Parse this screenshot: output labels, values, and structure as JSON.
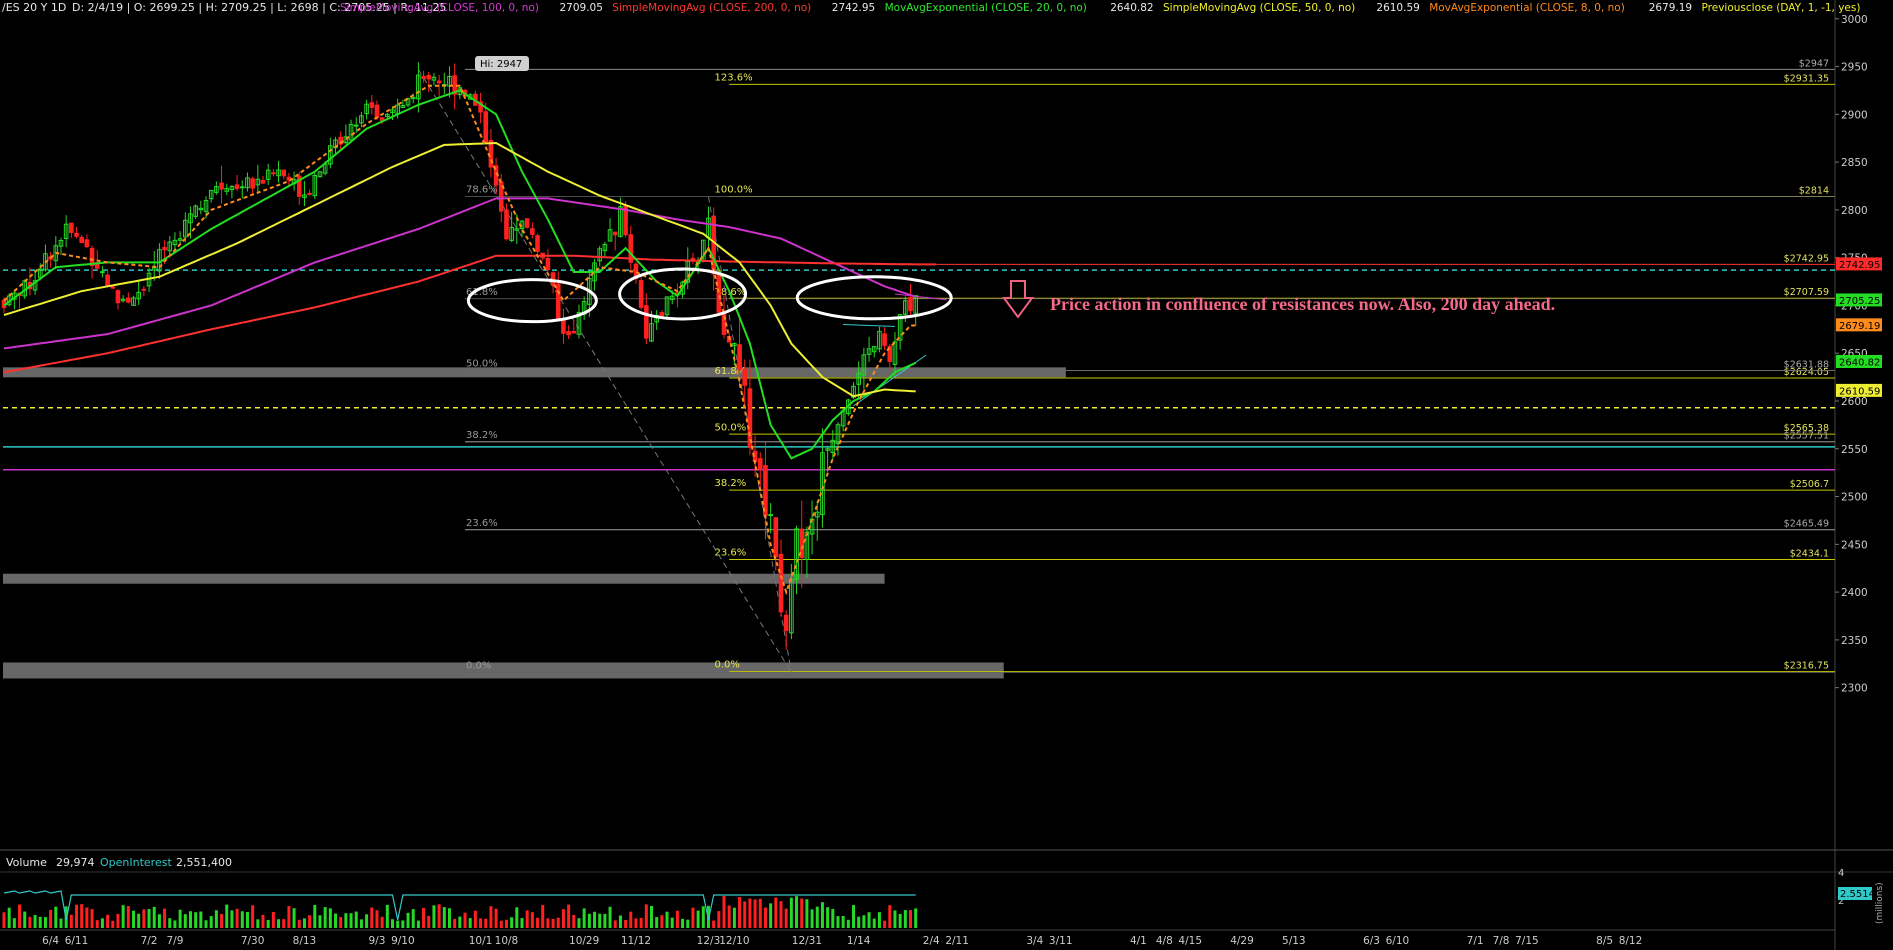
{
  "header": {
    "symbol": "/ES 20 Y 1D",
    "ohlc": "D: 2/4/19 | O: 2699.25 | H: 2709.25 | L: 2698 | C: 2705.25 | R: 11.25",
    "studies": [
      {
        "label": "SimpleMovingAvg (CLOSE, 100, 0, no)",
        "value": "2709.05",
        "color": "#d43ad4"
      },
      {
        "label": "SimpleMovingAvg (CLOSE, 200, 0, no)",
        "value": "2742.95",
        "color": "#ff3b30"
      },
      {
        "label": "MovAvgExponential (CLOSE, 20, 0, no)",
        "value": "2640.82",
        "color": "#2ee82e"
      },
      {
        "label": "SimpleMovingAvg (CLOSE, 50, 0, no)",
        "value": "2610.59",
        "color": "#f0f02a"
      },
      {
        "label": "MovAvgExponential (CLOSE, 8, 0, no)",
        "value": "2679.19",
        "color": "#ff8a1c"
      },
      {
        "label": "Previousclose (DAY, 1, -1, yes)",
        "value": "",
        "color": "#f0f02a"
      }
    ]
  },
  "colors": {
    "bg": "#000000",
    "up": "#26d926",
    "down": "#ff2020",
    "sma100": "#cc33cc",
    "sma200": "#ff3030",
    "ema20": "#22dd22",
    "sma50": "#eeee33",
    "ema8": "#ff8c1a",
    "fib": "#c8c800",
    "cyan": "#30c8c8"
  },
  "chart_data": {
    "type": "candlestick",
    "title": "/ES 20 Y 1D",
    "ylim": [
      2285,
      3005
    ],
    "yticks": [
      2300,
      2350,
      2400,
      2450,
      2500,
      2550,
      2600,
      2650,
      2700,
      2750,
      2800,
      2850,
      2900,
      2950,
      3000
    ],
    "xticks": [
      {
        "label": "6/4",
        "i": 9
      },
      {
        "label": "6/11",
        "i": 14
      },
      {
        "label": "7/2",
        "i": 28
      },
      {
        "label": "7/9",
        "i": 33
      },
      {
        "label": "7/30",
        "i": 48
      },
      {
        "label": "8/13",
        "i": 58
      },
      {
        "label": "9/3",
        "i": 72
      },
      {
        "label": "9/10",
        "i": 77
      },
      {
        "label": "10/1",
        "i": 92
      },
      {
        "label": "10/8",
        "i": 97
      },
      {
        "label": "10/29",
        "i": 112
      },
      {
        "label": "11/12",
        "i": 122
      },
      {
        "label": "12/3",
        "i": 136
      },
      {
        "label": "12/10",
        "i": 141
      },
      {
        "label": "12/31",
        "i": 155
      },
      {
        "label": "1/14",
        "i": 165
      },
      {
        "label": "2/4",
        "i": 179
      },
      {
        "label": "2/11",
        "i": 184
      },
      {
        "label": "3/4",
        "i": 199
      },
      {
        "label": "3/11",
        "i": 204
      },
      {
        "label": "4/1",
        "i": 219
      },
      {
        "label": "4/8",
        "i": 224
      },
      {
        "label": "4/15",
        "i": 229
      },
      {
        "label": "4/29",
        "i": 239
      },
      {
        "label": "5/13",
        "i": 249
      },
      {
        "label": "6/3",
        "i": 264
      },
      {
        "label": "6/10",
        "i": 269
      },
      {
        "label": "7/1",
        "i": 284
      },
      {
        "label": "7/8",
        "i": 289
      },
      {
        "label": "7/15",
        "i": 294
      },
      {
        "label": "8/5",
        "i": 309
      },
      {
        "label": "8/12",
        "i": 314
      }
    ],
    "anchors": [
      [
        0,
        2705
      ],
      [
        5,
        2725
      ],
      [
        12,
        2780
      ],
      [
        17,
        2755
      ],
      [
        22,
        2705
      ],
      [
        27,
        2715
      ],
      [
        30,
        2750
      ],
      [
        36,
        2800
      ],
      [
        42,
        2825
      ],
      [
        47,
        2830
      ],
      [
        53,
        2840
      ],
      [
        58,
        2820
      ],
      [
        63,
        2860
      ],
      [
        68,
        2900
      ],
      [
        73,
        2895
      ],
      [
        78,
        2915
      ],
      [
        82,
        2945
      ],
      [
        85,
        2935
      ],
      [
        88,
        2930
      ],
      [
        92,
        2905
      ],
      [
        95,
        2825
      ],
      [
        97,
        2765
      ],
      [
        99,
        2790
      ],
      [
        102,
        2775
      ],
      [
        105,
        2735
      ],
      [
        108,
        2665
      ],
      [
        111,
        2685
      ],
      [
        115,
        2755
      ],
      [
        119,
        2795
      ],
      [
        122,
        2730
      ],
      [
        124,
        2670
      ],
      [
        126,
        2680
      ],
      [
        130,
        2720
      ],
      [
        134,
        2750
      ],
      [
        136,
        2790
      ],
      [
        138,
        2690
      ],
      [
        140,
        2665
      ],
      [
        143,
        2600
      ],
      [
        146,
        2520
      ],
      [
        148,
        2480
      ],
      [
        150,
        2400
      ],
      [
        151,
        2350
      ],
      [
        152,
        2430
      ],
      [
        154,
        2460
      ],
      [
        156,
        2465
      ],
      [
        157,
        2500
      ],
      [
        159,
        2550
      ],
      [
        161,
        2580
      ],
      [
        163,
        2605
      ],
      [
        165,
        2625
      ],
      [
        167,
        2650
      ],
      [
        169,
        2670
      ],
      [
        171,
        2640
      ],
      [
        173,
        2685
      ],
      [
        175,
        2705
      ]
    ],
    "moving_averages": [
      {
        "name": "SMA100",
        "color": "#cc33cc",
        "points": [
          [
            0,
            2655
          ],
          [
            20,
            2670
          ],
          [
            40,
            2700
          ],
          [
            60,
            2745
          ],
          [
            80,
            2780
          ],
          [
            95,
            2812
          ],
          [
            105,
            2812
          ],
          [
            120,
            2800
          ],
          [
            130,
            2790
          ],
          [
            140,
            2782
          ],
          [
            150,
            2770
          ],
          [
            160,
            2745
          ],
          [
            170,
            2720
          ],
          [
            176,
            2709
          ]
        ]
      },
      {
        "name": "SMA200",
        "color": "#ff3030",
        "points": [
          [
            0,
            2630
          ],
          [
            20,
            2650
          ],
          [
            40,
            2675
          ],
          [
            60,
            2698
          ],
          [
            80,
            2725
          ],
          [
            95,
            2752
          ],
          [
            110,
            2752
          ],
          [
            125,
            2748
          ],
          [
            140,
            2746
          ],
          [
            160,
            2744
          ],
          [
            176,
            2743
          ]
        ]
      },
      {
        "name": "EMA20",
        "color": "#22dd22",
        "points": [
          [
            0,
            2700
          ],
          [
            10,
            2740
          ],
          [
            20,
            2745
          ],
          [
            30,
            2745
          ],
          [
            40,
            2780
          ],
          [
            50,
            2810
          ],
          [
            60,
            2840
          ],
          [
            70,
            2885
          ],
          [
            80,
            2910
          ],
          [
            88,
            2925
          ],
          [
            95,
            2900
          ],
          [
            100,
            2840
          ],
          [
            105,
            2790
          ],
          [
            110,
            2735
          ],
          [
            115,
            2735
          ],
          [
            120,
            2760
          ],
          [
            126,
            2725
          ],
          [
            130,
            2710
          ],
          [
            136,
            2760
          ],
          [
            140,
            2715
          ],
          [
            144,
            2660
          ],
          [
            148,
            2575
          ],
          [
            152,
            2540
          ],
          [
            156,
            2550
          ],
          [
            160,
            2580
          ],
          [
            164,
            2600
          ],
          [
            168,
            2610
          ],
          [
            172,
            2630
          ],
          [
            176,
            2640
          ]
        ]
      },
      {
        "name": "SMA50",
        "color": "#eeee33",
        "points": [
          [
            0,
            2690
          ],
          [
            15,
            2715
          ],
          [
            30,
            2730
          ],
          [
            45,
            2765
          ],
          [
            60,
            2805
          ],
          [
            75,
            2845
          ],
          [
            85,
            2868
          ],
          [
            95,
            2870
          ],
          [
            105,
            2840
          ],
          [
            115,
            2815
          ],
          [
            125,
            2795
          ],
          [
            135,
            2775
          ],
          [
            142,
            2745
          ],
          [
            148,
            2700
          ],
          [
            152,
            2660
          ],
          [
            158,
            2625
          ],
          [
            164,
            2605
          ],
          [
            170,
            2612
          ],
          [
            176,
            2610
          ]
        ]
      },
      {
        "name": "EMA8",
        "color": "#ff8c1a",
        "points": [
          [
            0,
            2705
          ],
          [
            10,
            2755
          ],
          [
            20,
            2745
          ],
          [
            30,
            2740
          ],
          [
            40,
            2800
          ],
          [
            55,
            2830
          ],
          [
            70,
            2890
          ],
          [
            82,
            2930
          ],
          [
            88,
            2930
          ],
          [
            95,
            2840
          ],
          [
            100,
            2780
          ],
          [
            108,
            2705
          ],
          [
            115,
            2740
          ],
          [
            122,
            2735
          ],
          [
            130,
            2715
          ],
          [
            136,
            2760
          ],
          [
            142,
            2620
          ],
          [
            148,
            2450
          ],
          [
            151,
            2400
          ],
          [
            155,
            2460
          ],
          [
            160,
            2540
          ],
          [
            165,
            2600
          ],
          [
            170,
            2650
          ],
          [
            175,
            2679
          ]
        ]
      }
    ],
    "horizontal_levels": [
      {
        "label": "$2947",
        "value": 2947,
        "color": "#888888",
        "from": 89
      },
      {
        "label": "$2931.35",
        "value": 2931.35,
        "color": "#c8c800",
        "from": 140
      },
      {
        "label": "$2814",
        "value": 2814,
        "color": "#c8c800",
        "from": 140
      },
      {
        "label": "$2742.95",
        "value": 2742.95,
        "color": "#ff3030",
        "from": 168,
        "short": true
      },
      {
        "label": "$2707.59",
        "value": 2707.59,
        "color": "#c8c800",
        "from": 140
      },
      {
        "label": "$2631.88",
        "value": 2631.88,
        "color": "#888888",
        "from": 89
      },
      {
        "label": "$2624.05",
        "value": 2624.05,
        "color": "#c8c800",
        "from": 140
      },
      {
        "label": "$2565.38",
        "value": 2565.38,
        "color": "#c8c800",
        "from": 140
      },
      {
        "label": "$2557.51",
        "value": 2557.51,
        "color": "#888888",
        "from": 89
      },
      {
        "label": "$2506.7",
        "value": 2506.7,
        "color": "#c8c800",
        "from": 140
      },
      {
        "label": "$2465.49",
        "value": 2465.49,
        "color": "#888888",
        "from": 89
      },
      {
        "label": "$2434.1",
        "value": 2434.1,
        "color": "#c8c800",
        "from": 140
      },
      {
        "label": "$2316.75",
        "value": 2316.75,
        "color": "#c8c800",
        "from": 140
      }
    ],
    "fib_a": [
      {
        "label": "78.6%",
        "value": 2814
      },
      {
        "label": "61.8%",
        "value": 2707
      },
      {
        "label": "50.0%",
        "value": 2632
      },
      {
        "label": "38.2%",
        "value": 2557
      },
      {
        "label": "23.6%",
        "value": 2465
      },
      {
        "label": "0.0%",
        "value": 2316
      }
    ],
    "fib_b": [
      {
        "label": "123.6%",
        "value": 2931
      },
      {
        "label": "100.0%",
        "value": 2814
      },
      {
        "label": "78.6%",
        "value": 2707
      },
      {
        "label": "61.8%",
        "value": 2624
      },
      {
        "label": "50.0%",
        "value": 2565
      },
      {
        "label": "38.2%",
        "value": 2507
      },
      {
        "label": "23.6%",
        "value": 2434
      },
      {
        "label": "0.0%",
        "value": 2317
      }
    ],
    "dashed_levels": [
      {
        "value": 2737,
        "color": "#30c8c8"
      },
      {
        "value": 2593,
        "color": "#eeee33"
      }
    ],
    "solid_levels": [
      {
        "value": 2552,
        "color": "#30c8c8"
      },
      {
        "value": 2528,
        "color": "#cc33cc"
      }
    ],
    "zones": [
      {
        "value": 2630,
        "to_i": 205
      },
      {
        "value": 2414,
        "to_i": 170
      },
      {
        "value": 2318,
        "to_i": 193
      }
    ],
    "price_tags": [
      {
        "label": "2742.95",
        "value": 2742.95,
        "bg": "#ff2a2a",
        "fg": "#000000"
      },
      {
        "label": "2705.25",
        "value": 2705.25,
        "bg": "#22dd22",
        "fg": "#000000"
      },
      {
        "label": "2679.19",
        "value": 2679.19,
        "bg": "#ff8c1a",
        "fg": "#000000"
      },
      {
        "label": "2640.82",
        "value": 2640.82,
        "bg": "#22dd22",
        "fg": "#000000"
      },
      {
        "label": "2610.59",
        "value": 2610.59,
        "bg": "#eeee33",
        "fg": "#000000"
      }
    ],
    "high_label": "Hi: 2947",
    "annotation": "Price action in confluence of resistances now. Also, 200 day ahead.",
    "volume": {
      "label": "Volume",
      "value": "29,974",
      "oi_label": "OpenInterest",
      "oi_value": "2,551,400",
      "yticks": [
        "4",
        "2"
      ],
      "oi_tag": "2.5514",
      "units": "(millions)"
    }
  }
}
